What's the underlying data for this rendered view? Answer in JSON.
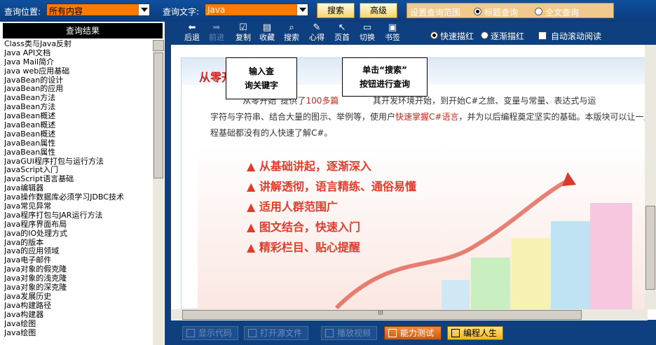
{
  "search": {
    "location_label": "查询位置:",
    "location_value": "所有内容",
    "text_label": "查询文字:",
    "text_value": "Java",
    "search_button": "搜索",
    "advanced_button": "高级",
    "range_label": "设置查询范围",
    "range_title": "标题查询",
    "range_fulltext": "全文查询"
  },
  "results": {
    "header": "查询结果",
    "items": [
      "Class类与Java反射",
      "Java API文档",
      "Java Mail简介",
      "java web应用基础",
      "JavaBean的设计",
      "JavaBean的应用",
      "JavaBean方法",
      "JavaBean方法",
      "JavaBean概述",
      "JavaBean概述",
      "JavaBean概述",
      "JavaBean属性",
      "JavaBean属性",
      "JavaGUI程序打包与运行方法",
      "JavaScript入门",
      "JavaScript语言基础",
      "Java编辑器",
      "Java操作数据库必须学习JDBC技术",
      "Java常见异常",
      "Java程序打包与JAR运行方法",
      "Java程序界面布局",
      "Java的IO处理方式",
      "Java的版本",
      "Java的应用领域",
      "Java电子邮件",
      "Java对象的假克隆",
      "Java对象的浅克隆",
      "Java对象的深克隆",
      "Java发展历史",
      "Java构建路径",
      "Java构建器",
      "Java绘图",
      "Java绘图"
    ]
  },
  "toolbar": {
    "back": "后退",
    "forward": "前进",
    "copy": "复制",
    "favorite": "收藏",
    "search": "搜索",
    "notes": "心得",
    "page": "页首",
    "switch": "切换",
    "bookmark": "书签",
    "quick_red": "快速描红",
    "step_red": "逐渐描红",
    "auto_scroll": "自动滚动阅读"
  },
  "content": {
    "heading": "从零开始学C#",
    "line1_a": "“从零开始”提供了",
    "line1_b": "100多篇",
    "line1_c": "其开发环境开始，到开始C#之旅、变量与常量、表达式与运",
    "line2_a": "字符与字符串、结合大量的图示、举例等，使用户",
    "line2_b": "快速掌握C#语言",
    "line2_c": "，并为以后编程奠定坚实的基础。本版块可以让一点",
    "line3": "程基础都没有的人快速了解C#。",
    "features": [
      "▲ 从基础讲起，逐渐深入",
      "▲ 讲解透彻，语言精练、通俗易懂",
      "▲ 适用人群范围广",
      "▲ 图文结合，快速入门",
      "▲ 精彩栏目、贴心提醒"
    ],
    "hscroll_mark": "III"
  },
  "callouts": {
    "left_line1": "输入查",
    "left_line2": "询关键字",
    "right_line1": "单击“搜索”",
    "right_line2": "按钮进行查询"
  },
  "bottom": {
    "show_code": "显示代码",
    "open_file": "打开源文件",
    "open_video": "播放视频",
    "ability_test": "能力测试",
    "programming_life": "编程人生"
  },
  "colors": {
    "accent_orange": "#ff7a00",
    "frame_blue": "#0e3f7e",
    "heading_red": "#d1261c"
  }
}
